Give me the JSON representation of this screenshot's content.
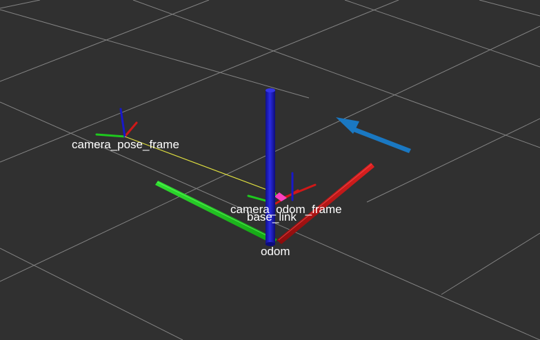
{
  "scene": {
    "background_color": "#303030",
    "grid_color": "#a0a0a0",
    "colors": {
      "x_axis": "#d01818",
      "y_axis": "#1ec81e",
      "z_axis": "#1818c8",
      "pose_arrow": "#1a78c2",
      "tf_link": "#e0e040",
      "marker": "#ff40c0"
    },
    "frames": [
      {
        "id": "odom",
        "label": "odom"
      },
      {
        "id": "base_link",
        "label": "base_link"
      },
      {
        "id": "camera_odom_frame",
        "label": "camera_odom_frame"
      },
      {
        "id": "camera_pose_frame",
        "label": "camera_pose_frame"
      }
    ],
    "pose_arrow_icon": "arrow-icon"
  }
}
